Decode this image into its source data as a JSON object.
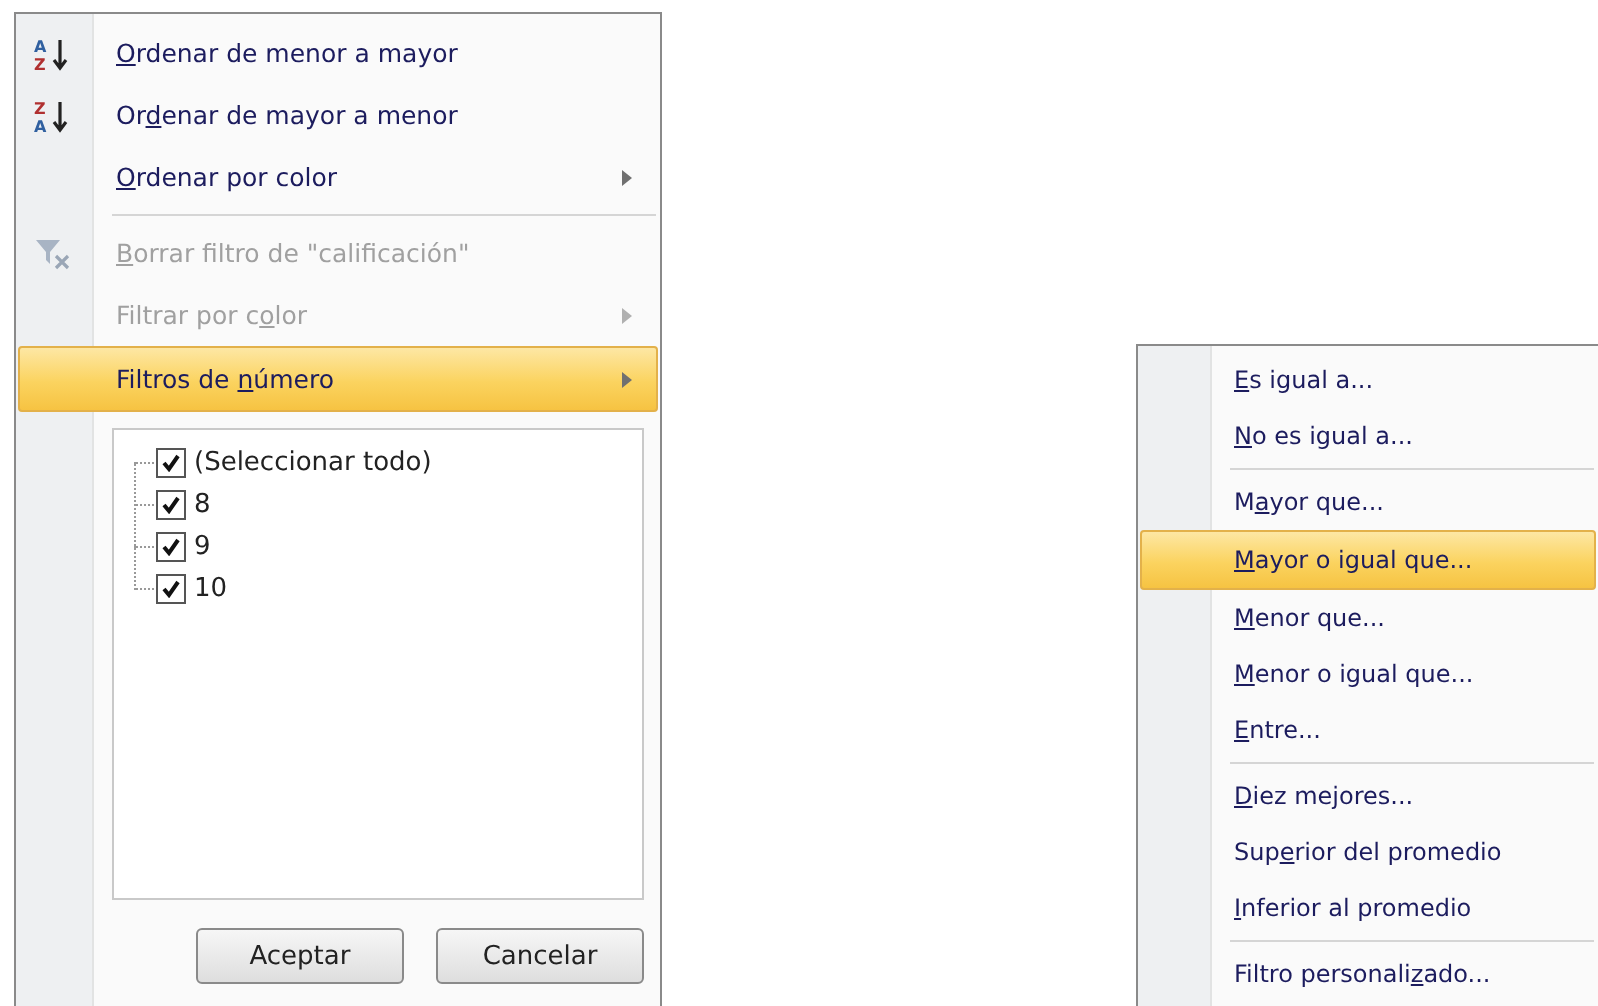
{
  "filter_menu": {
    "items": [
      {
        "kind": "sort_up",
        "icon_text": [
          "A",
          "Z"
        ],
        "label": {
          "key": "O",
          "post": "rdenar de menor a mayor"
        },
        "disabled": false,
        "selected": false,
        "submenu": false
      },
      {
        "kind": "sort_down",
        "icon_text": [
          "Z",
          "A"
        ],
        "label": {
          "pre": "Or",
          "key": "d",
          "post": "enar de mayor a menor"
        },
        "disabled": false,
        "selected": false,
        "submenu": false
      },
      {
        "kind": "plain",
        "label": {
          "key": "O",
          "post": "rdenar por color"
        },
        "disabled": false,
        "selected": false,
        "submenu": true
      },
      {
        "kind": "separator"
      },
      {
        "kind": "clear_filter",
        "label": {
          "key": "B",
          "post": "orrar filtro de \"calificación\""
        },
        "disabled": true,
        "selected": false,
        "submenu": false
      },
      {
        "kind": "plain",
        "label": {
          "pre": "Filtrar por c",
          "key": "o",
          "post": "lor"
        },
        "disabled": true,
        "selected": false,
        "submenu": true
      },
      {
        "kind": "plain",
        "label": {
          "pre": "Filtros de ",
          "key": "n",
          "post": "úmero"
        },
        "disabled": false,
        "selected": true,
        "submenu": true
      }
    ],
    "values": [
      {
        "label": "(Seleccionar todo)",
        "checked": true
      },
      {
        "label": "8",
        "checked": true
      },
      {
        "label": "9",
        "checked": true
      },
      {
        "label": "10",
        "checked": true
      }
    ],
    "buttons": [
      "Aceptar",
      "Cancelar"
    ]
  },
  "number_filters_menu": {
    "items": [
      {
        "kind": "plain",
        "label": {
          "key": "E",
          "post": "s igual a..."
        },
        "selected": false
      },
      {
        "kind": "plain",
        "label": {
          "key": "N",
          "post": "o es igual a..."
        },
        "selected": false
      },
      {
        "kind": "separator"
      },
      {
        "kind": "plain",
        "label": {
          "pre": "M",
          "key": "a",
          "post": "yor que..."
        },
        "selected": false
      },
      {
        "kind": "plain",
        "label": {
          "key": "M",
          "post": "ayor o igual que..."
        },
        "selected": true
      },
      {
        "kind": "plain",
        "label": {
          "key": "M",
          "post": "enor que..."
        },
        "selected": false
      },
      {
        "kind": "plain",
        "label": {
          "key": "M",
          "post": "enor o igual que..."
        },
        "selected": false
      },
      {
        "kind": "plain",
        "label": {
          "key": "E",
          "post": "ntre..."
        },
        "selected": false
      },
      {
        "kind": "separator"
      },
      {
        "kind": "plain",
        "label": {
          "key": "D",
          "post": "iez mejores..."
        },
        "selected": false
      },
      {
        "kind": "plain",
        "label": {
          "pre": "Sup",
          "key": "e",
          "post": "rior del promedio"
        },
        "selected": false
      },
      {
        "kind": "plain",
        "label": {
          "key": "I",
          "post": "nferior al promedio"
        },
        "selected": false
      },
      {
        "kind": "separator"
      },
      {
        "kind": "plain",
        "label": {
          "pre": "Filtro personali",
          "key": "z",
          "post": "ado..."
        },
        "selected": false
      }
    ]
  }
}
